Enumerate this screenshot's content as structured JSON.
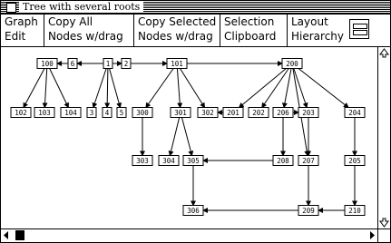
{
  "window": {
    "title": "Tree with several roots"
  },
  "menu": [
    {
      "line1": "Graph",
      "line2": "Edit"
    },
    {
      "line1": "Copy All",
      "line2": "Nodes w/drag"
    },
    {
      "line1": "Copy Selected",
      "line2": "Nodes w/drag"
    },
    {
      "line1": "Selection",
      "line2": "Clipboard"
    },
    {
      "line1": "Layout",
      "line2": "Hierarchy"
    }
  ],
  "graph": {
    "nodes": [
      {
        "id": "100",
        "label": "100"
      },
      {
        "id": "6",
        "label": "6"
      },
      {
        "id": "1",
        "label": "1"
      },
      {
        "id": "2",
        "label": "2"
      },
      {
        "id": "101",
        "label": "101"
      },
      {
        "id": "200",
        "label": "200"
      },
      {
        "id": "102",
        "label": "102"
      },
      {
        "id": "103",
        "label": "103"
      },
      {
        "id": "104",
        "label": "104"
      },
      {
        "id": "3",
        "label": "3"
      },
      {
        "id": "4",
        "label": "4"
      },
      {
        "id": "5",
        "label": "5"
      },
      {
        "id": "300",
        "label": "300"
      },
      {
        "id": "301",
        "label": "301"
      },
      {
        "id": "302",
        "label": "302"
      },
      {
        "id": "201",
        "label": "201"
      },
      {
        "id": "202",
        "label": "202"
      },
      {
        "id": "206",
        "label": "206"
      },
      {
        "id": "203",
        "label": "203"
      },
      {
        "id": "204",
        "label": "204"
      },
      {
        "id": "303",
        "label": "303"
      },
      {
        "id": "304",
        "label": "304"
      },
      {
        "id": "305",
        "label": "305"
      },
      {
        "id": "208",
        "label": "208"
      },
      {
        "id": "207",
        "label": "207"
      },
      {
        "id": "205",
        "label": "205"
      },
      {
        "id": "306",
        "label": "306"
      },
      {
        "id": "209",
        "label": "209"
      },
      {
        "id": "210",
        "label": "210"
      }
    ],
    "edges": [
      [
        "100",
        "102"
      ],
      [
        "100",
        "103"
      ],
      [
        "100",
        "104"
      ],
      [
        "6",
        "100"
      ],
      [
        "1",
        "6"
      ],
      [
        "1",
        "2"
      ],
      [
        "1",
        "3"
      ],
      [
        "1",
        "4"
      ],
      [
        "1",
        "5"
      ],
      [
        "2",
        "101"
      ],
      [
        "101",
        "200"
      ],
      [
        "101",
        "300"
      ],
      [
        "101",
        "301"
      ],
      [
        "101",
        "302"
      ],
      [
        "200",
        "201"
      ],
      [
        "200",
        "202"
      ],
      [
        "200",
        "206"
      ],
      [
        "200",
        "203"
      ],
      [
        "200",
        "204"
      ],
      [
        "200",
        "207"
      ],
      [
        "201",
        "302"
      ],
      [
        "206",
        "203"
      ],
      [
        "300",
        "303"
      ],
      [
        "301",
        "304"
      ],
      [
        "301",
        "305"
      ],
      [
        "206",
        "208"
      ],
      [
        "203",
        "207"
      ],
      [
        "204",
        "205"
      ],
      [
        "208",
        "305"
      ],
      [
        "305",
        "306"
      ],
      [
        "207",
        "209"
      ],
      [
        "205",
        "210"
      ],
      [
        "210",
        "209"
      ],
      [
        "209",
        "306"
      ]
    ]
  }
}
